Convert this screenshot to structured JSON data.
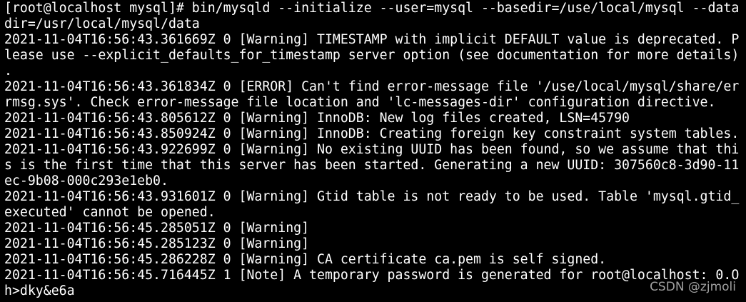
{
  "terminal": {
    "background": "#000000",
    "foreground": "#ffffff",
    "lines": [
      "[root@localhost mysql]# bin/mysqld --initialize --user=mysql --basedir=/use/local/mysql --data",
      "dir=/usr/local/mysql/data",
      "2021-11-04T16:56:43.361669Z 0 [Warning] TIMESTAMP with implicit DEFAULT value is deprecated. P",
      "lease use --explicit_defaults_for_timestamp server option (see documentation for more details)",
      ".",
      "2021-11-04T16:56:43.361834Z 0 [ERROR] Can't find error-message file '/use/local/mysql/share/er",
      "rmsg.sys'. Check error-message file location and 'lc-messages-dir' configuration directive.",
      "2021-11-04T16:56:43.805612Z 0 [Warning] InnoDB: New log files created, LSN=45790",
      "2021-11-04T16:56:43.850924Z 0 [Warning] InnoDB: Creating foreign key constraint system tables.",
      "2021-11-04T16:56:43.922699Z 0 [Warning] No existing UUID has been found, so we assume that thi",
      "s is the first time that this server has been started. Generating a new UUID: 307560c8-3d90-11",
      "ec-9b08-000c293e1eb0.",
      "2021-11-04T16:56:43.931601Z 0 [Warning] Gtid table is not ready to be used. Table 'mysql.gtid_",
      "executed' cannot be opened.",
      "2021-11-04T16:56:45.285051Z 0 [Warning]",
      "2021-11-04T16:56:45.285123Z 0 [Warning]",
      "2021-11-04T16:56:45.286228Z 0 [Warning] CA certificate ca.pem is self signed.",
      "2021-11-04T16:56:45.716445Z 1 [Note] A temporary password is generated for root@localhost: 0.O",
      "h>dky&e6a"
    ]
  },
  "watermark": {
    "text": "CSDN @zjmoli"
  }
}
